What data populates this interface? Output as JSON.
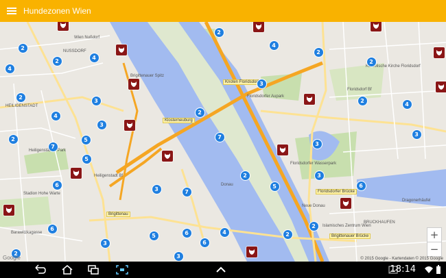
{
  "app": {
    "title": "Hundezonen Wien",
    "accent": "#f9b200",
    "marker_blue": "#1f7fe0",
    "marker_dog": "#8a1616"
  },
  "clusters": [
    "2",
    "4",
    "2",
    "4",
    "3",
    "2",
    "4",
    "2",
    "3",
    "3",
    "3",
    "4",
    "2",
    "2",
    "5",
    "7",
    "5",
    "7",
    "2",
    "2",
    "3",
    "3",
    "6",
    "6",
    "2",
    "2",
    "7",
    "5",
    "6",
    "4",
    "3",
    "6",
    "2",
    "3",
    "5",
    "6",
    "2",
    "3",
    "4",
    "2"
  ],
  "labels": {
    "wien_nussdorf": "Wien Nußdorf",
    "nussdorf": "NUSSDORF",
    "heiligenstadt": "HEILIGENSTADT",
    "heiligenstaedter_park": "Heiligenstädter Park",
    "heiligenstadt_bf": "Heiligenstadt Bf",
    "stadion": "Stadion Hohe Warte",
    "barawitzkagasse": "Barawitzkagasse",
    "brigittenau_spitz": "Brigittenauer Spitz",
    "floridsdorfer_aupark": "Floridsdorfer Aupark",
    "floridsdorf_bf": "Floridsdorf Bf",
    "katholische_kirche": "Katholische Kirche Floridsdorf",
    "wasserpark": "Floridsdorfer Wasserpark",
    "neue_donau": "Neue Donau",
    "islamisches_zentrum": "Islamisches Zentrum Wien",
    "dragonerhaufel": "Dragonerhäufel",
    "bruckhaufen": "BRUCKHAUFEN",
    "donau": "Donau"
  },
  "road_tags": {
    "knoten": "Knoten Floridsdorf",
    "klosterneuburg": "Klosterneuburg",
    "floridsdorfer_bruecke": "Floridsdorfer Brücke",
    "brigittenauer_bruecke": "Brigittenauer Brücke",
    "brigittenau": "Brigittenau"
  },
  "map": {
    "attribution": "© 2015 Google - Kartendaten © 2015 Google",
    "google": "Google",
    "zoom_in": "+",
    "zoom_out": "−"
  },
  "system": {
    "clock": "18:14"
  }
}
